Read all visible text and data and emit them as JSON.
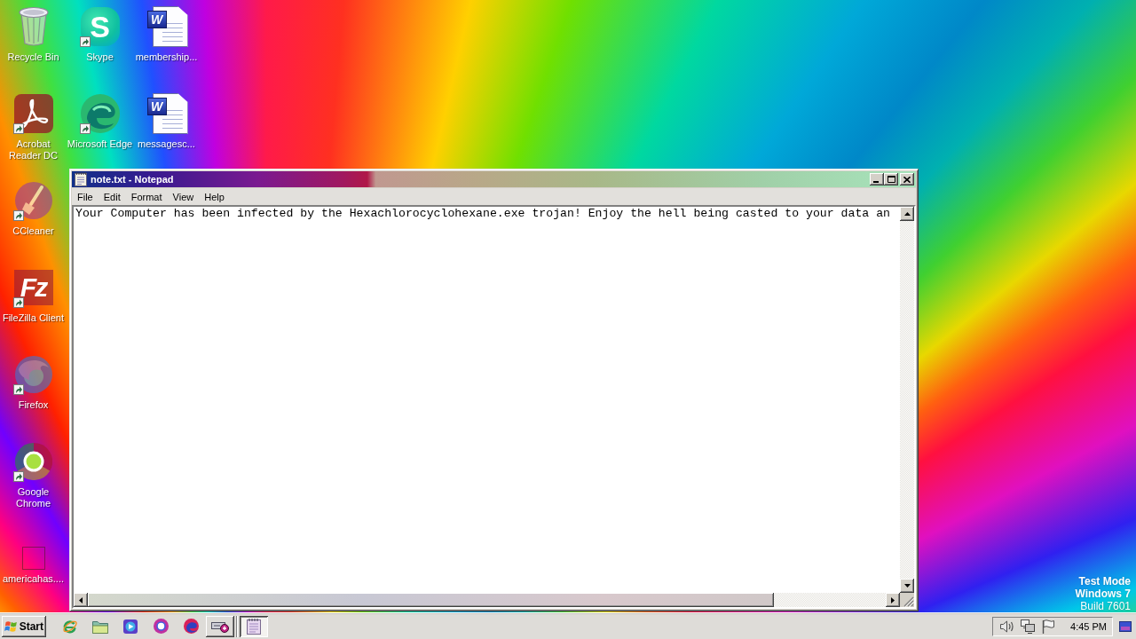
{
  "desktop": {
    "icon_columns": [
      [
        {
          "label": "Recycle Bin",
          "kind": "recycle-bin",
          "shortcut": false
        },
        {
          "label": "Acrobat Reader DC",
          "kind": "acrobat",
          "shortcut": true
        },
        {
          "label": "CCleaner",
          "kind": "ccleaner",
          "shortcut": true
        },
        {
          "label": "FileZilla Client",
          "kind": "filezilla",
          "glyph": "Fz",
          "shortcut": true
        },
        {
          "label": "Firefox",
          "kind": "firefox",
          "shortcut": true
        },
        {
          "label": "Google Chrome",
          "kind": "chrome",
          "shortcut": true
        },
        {
          "label": "americahas....",
          "kind": "blank",
          "shortcut": false
        }
      ],
      [
        {
          "label": "Skype",
          "kind": "skype",
          "glyph": "S",
          "shortcut": true
        },
        {
          "label": "Microsoft Edge",
          "kind": "edge",
          "shortcut": true
        }
      ],
      [
        {
          "label": "membership...",
          "kind": "word-document",
          "glyph": "W",
          "shortcut": false
        },
        {
          "label": "messagesc...",
          "kind": "word-document",
          "glyph": "W",
          "shortcut": false
        }
      ]
    ],
    "notice": {
      "mode": "Test Mode",
      "os": "Windows 7",
      "build": "Build 7601"
    }
  },
  "window": {
    "title": "note.txt - Notepad",
    "menu": [
      "File",
      "Edit",
      "Format",
      "View",
      "Help"
    ],
    "text": "Your Computer has been infected by the Hexachlorocyclohexane.exe trojan! Enjoy the hell being casted to your data an"
  },
  "taskbar": {
    "start": "Start",
    "quick_launch": [
      {
        "kind": "ie"
      },
      {
        "kind": "folder"
      },
      {
        "kind": "media-player"
      },
      {
        "kind": "chrome"
      },
      {
        "kind": "edge"
      }
    ],
    "task_buttons": [
      {
        "kind": "drive",
        "selected": false
      },
      {
        "kind": "notepad",
        "selected": true
      }
    ],
    "tray": [
      {
        "kind": "speaker"
      },
      {
        "kind": "network"
      },
      {
        "kind": "flag"
      }
    ],
    "clock": "4:45 PM"
  }
}
